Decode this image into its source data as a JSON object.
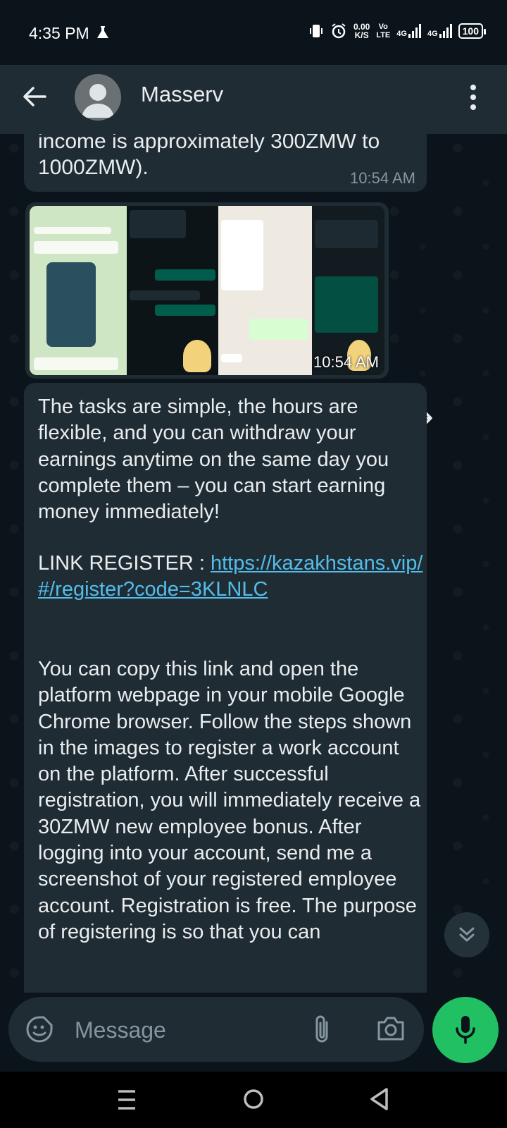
{
  "status": {
    "time": "4:35 PM",
    "speed_value": "0.00",
    "speed_unit": "K/S",
    "volte_top": "Vo",
    "volte_bottom": "LTE",
    "net1": "4G",
    "net2": "4G",
    "battery": "100"
  },
  "header": {
    "contact_name": "Masserv"
  },
  "messages": [
    {
      "text": "income is approximately 300ZMW to 1000ZMW).",
      "time": "10:54 AM"
    },
    {
      "type": "image",
      "time": "10:54 AM"
    },
    {
      "para1": "The tasks are simple, the hours are flexible, and you can withdraw your earnings anytime on the same day you complete them – you can start earning money immediately!",
      "link_label": "LINK REGISTER   : ",
      "link_url": "https://kazakhstans.vip/#/register?code=3KLNLC",
      "para2": "You can copy this link and open the platform webpage in your mobile Google Chrome browser. Follow the steps shown in the images to register a work account on the platform. After successful registration, you will immediately receive a 30ZMW new employee bonus. After logging into your account, send me a screenshot of your registered employee account. Registration is free. The purpose of registering is so that you can"
    }
  ],
  "composer": {
    "placeholder": "Message"
  },
  "icons": {
    "back": "arrow-left-icon",
    "menu": "more-vertical-icon",
    "forward": "forward-icon",
    "scroll": "chevron-double-down-icon",
    "emoji": "sticker-icon",
    "attach": "paperclip-icon",
    "camera": "camera-icon",
    "mic": "microphone-icon"
  },
  "colors": {
    "background": "#0b141a",
    "bubble": "#202c33",
    "header": "#1f2c34",
    "link": "#53bdeb",
    "mic_button": "#21c063"
  }
}
